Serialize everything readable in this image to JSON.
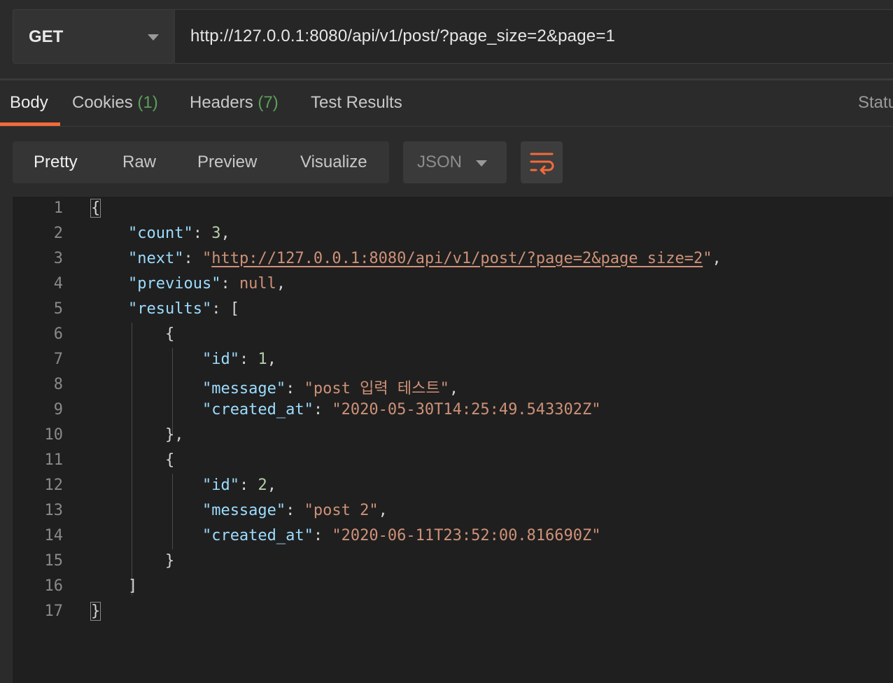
{
  "request": {
    "method": "GET",
    "url": "http://127.0.0.1:8080/api/v1/post/?page_size=2&page=1"
  },
  "response_tabs": [
    {
      "label": "Body",
      "count": ""
    },
    {
      "label": "Cookies",
      "count": "(1)"
    },
    {
      "label": "Headers",
      "count": "(7)"
    },
    {
      "label": "Test Results",
      "count": ""
    }
  ],
  "status_label": "Statu",
  "view_modes": [
    "Pretty",
    "Raw",
    "Preview",
    "Visualize"
  ],
  "format": "JSON",
  "icons": {
    "method_dropdown": "chevron-down-icon",
    "format_dropdown": "chevron-down-icon",
    "wrap": "wrap-lines-icon"
  },
  "colors": {
    "accent": "#f26b3a",
    "key": "#9cdcfe",
    "string": "#ce9178",
    "number": "#b5cea8",
    "count": "#5aa05a"
  },
  "body": {
    "line_numbers": [
      "1",
      "2",
      "3",
      "4",
      "5",
      "6",
      "7",
      "8",
      "9",
      "10",
      "11",
      "12",
      "13",
      "14",
      "15",
      "16",
      "17"
    ],
    "open_brace": "{",
    "close_brace": "}",
    "count_key": "\"count\"",
    "count_value": "3",
    "next_key": "\"next\"",
    "next_value": "http://127.0.0.1:8080/api/v1/post/?page=2&page_size=2",
    "previous_key": "\"previous\"",
    "previous_value": "null",
    "results_key": "\"results\"",
    "id_key": "\"id\"",
    "message_key": "\"message\"",
    "created_at_key": "\"created_at\"",
    "items": [
      {
        "id": "1",
        "message": "\"post 입력 테스트\"",
        "created_at": "\"2020-05-30T14:25:49.543302Z\""
      },
      {
        "id": "2",
        "message": "\"post 2\"",
        "created_at": "\"2020-06-11T23:52:00.816690Z\""
      }
    ]
  }
}
